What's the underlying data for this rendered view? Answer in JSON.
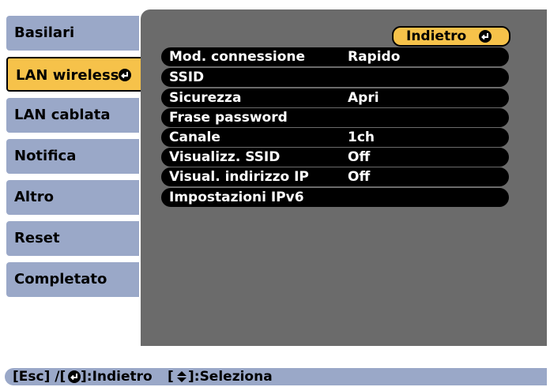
{
  "menu": {
    "items": [
      {
        "label": "Basilari"
      },
      {
        "label": "LAN wireless",
        "selected": true
      },
      {
        "label": "LAN cablata"
      },
      {
        "label": "Notifica"
      },
      {
        "label": "Altro"
      },
      {
        "label": "Reset"
      },
      {
        "label": "Completato"
      }
    ]
  },
  "panel": {
    "back_label": "Indietro",
    "rows": [
      {
        "name": "Mod. connessione",
        "value": "Rapido"
      },
      {
        "name": "SSID",
        "value": ""
      },
      {
        "name": "Sicurezza",
        "value": "Apri"
      },
      {
        "name": "Frase password",
        "value": ""
      },
      {
        "name": "Canale",
        "value": "1ch"
      },
      {
        "name": "Visualizz. SSID",
        "value": "Off"
      },
      {
        "name": "Visual. indirizzo IP",
        "value": "Off"
      },
      {
        "name": "Impostazioni IPv6",
        "value": ""
      }
    ]
  },
  "footer": {
    "part1": "[Esc] /[",
    "part2": "]:Indietro",
    "part3": "[",
    "part4": "]:Seleziona"
  },
  "colors": {
    "menu_bg": "#9aa8c8",
    "selected_bg": "#f6c24a",
    "panel_bg": "#6b6b6b",
    "row_bg": "#000000"
  },
  "icons": {
    "enter": "enter-icon",
    "up_down": "up-down-arrow-icon"
  }
}
